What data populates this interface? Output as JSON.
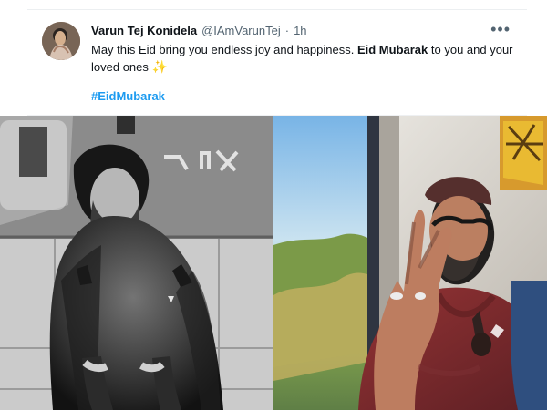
{
  "tweet": {
    "author_name": "Varun Tej Konidela",
    "author_handle": "@IAmVarunTej",
    "separator": "·",
    "time": "1h",
    "more_icon": "more-icon",
    "text_start": "May this Eid bring you endless joy and happiness.",
    "text_bold": "Eid Mubarak",
    "text_end": "to you and your loved ones",
    "sparkle_icon": "✨",
    "hashtag": "#EidMubarak"
  },
  "colors": {
    "link": "#1d9bf0",
    "text": "#0f1419",
    "muted": "#536471"
  }
}
